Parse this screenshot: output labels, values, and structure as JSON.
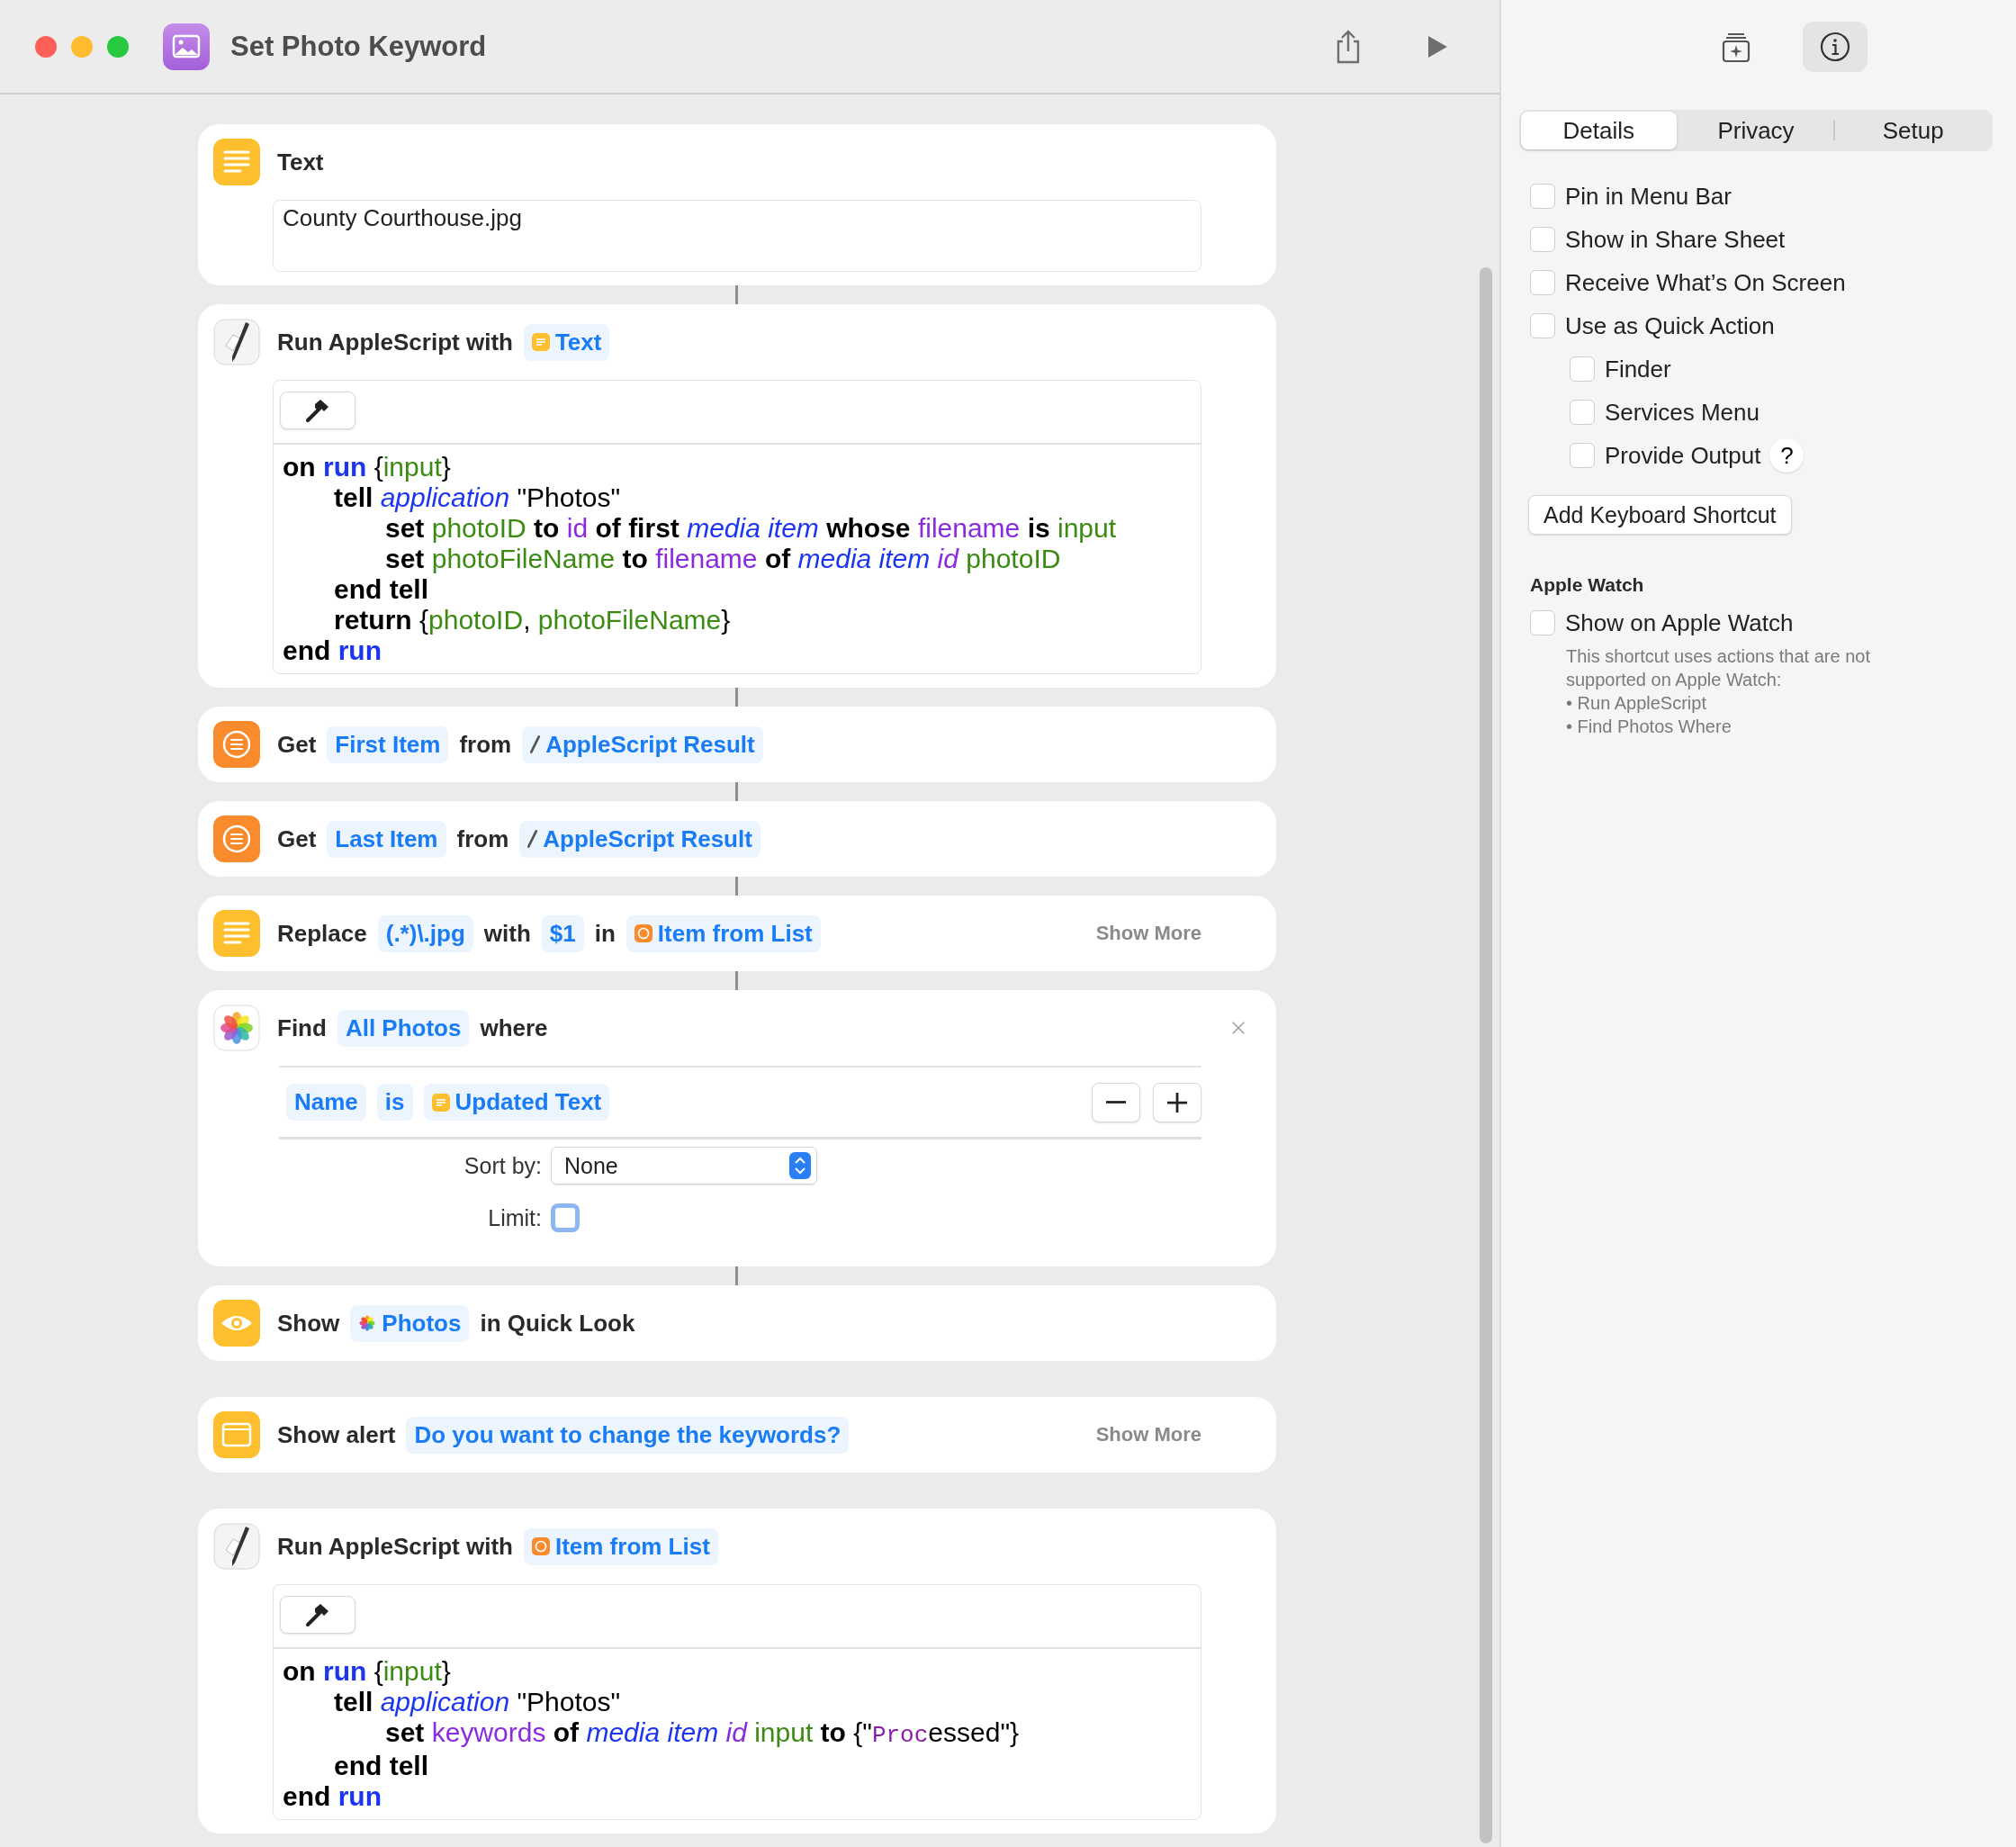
{
  "window": {
    "title": "Set Photo Keyword"
  },
  "actions": [
    {
      "kind": "text",
      "linked": false,
      "header": [
        {
          "kind": "word",
          "text": "Text"
        }
      ],
      "value": "County Courthouse.jpg"
    },
    {
      "kind": "script",
      "linked": true,
      "header": [
        {
          "kind": "word",
          "text": "Run AppleScript with"
        },
        {
          "kind": "text-result",
          "text": "Text"
        }
      ],
      "code": [
        {
          "tokens": [
            {
              "kind": "kw",
              "text": "on "
            },
            {
              "kind": "handler",
              "text": "run"
            },
            {
              "kind": "text",
              "text": " {"
            },
            {
              "kind": "var",
              "text": "input"
            },
            {
              "kind": "text",
              "text": "}"
            }
          ],
          "children": [
            {
              "tokens": [
                {
                  "kind": "kw",
                  "text": "tell "
                },
                {
                  "kind": "class",
                  "text": "application"
                },
                {
                  "kind": "text",
                  "text": " \"Photos\""
                }
              ],
              "children": [
                {
                  "tokens": [
                    {
                      "kind": "kw",
                      "text": "set "
                    },
                    {
                      "kind": "var",
                      "text": "photoID"
                    },
                    {
                      "kind": "kw",
                      "text": " to "
                    },
                    {
                      "kind": "prop",
                      "text": "id"
                    },
                    {
                      "kind": "kw",
                      "text": " of first "
                    },
                    {
                      "kind": "class",
                      "text": "media item"
                    },
                    {
                      "kind": "kw",
                      "text": " whose "
                    },
                    {
                      "kind": "prop",
                      "text": "filename"
                    },
                    {
                      "kind": "kw",
                      "text": " is "
                    },
                    {
                      "kind": "var",
                      "text": "input"
                    }
                  ]
                },
                {
                  "tokens": [
                    {
                      "kind": "kw",
                      "text": "set "
                    },
                    {
                      "kind": "var",
                      "text": "photoFileName"
                    },
                    {
                      "kind": "kw",
                      "text": " to "
                    },
                    {
                      "kind": "prop",
                      "text": "filename"
                    },
                    {
                      "kind": "kw",
                      "text": " of "
                    },
                    {
                      "kind": "class",
                      "text": "media item "
                    },
                    {
                      "kind": "propi",
                      "text": "id"
                    },
                    {
                      "kind": "var",
                      "text": " photoID"
                    }
                  ]
                }
              ]
            },
            {
              "tokens": [
                {
                  "kind": "kw",
                  "text": "end tell"
                }
              ]
            },
            {
              "tokens": [
                {
                  "kind": "kw",
                  "text": "return "
                },
                {
                  "kind": "text",
                  "text": "{"
                },
                {
                  "kind": "var",
                  "text": "photoID"
                },
                {
                  "kind": "text",
                  "text": ", "
                },
                {
                  "kind": "var",
                  "text": "photoFileName"
                },
                {
                  "kind": "text",
                  "text": "}"
                }
              ]
            }
          ]
        },
        {
          "tokens": [
            {
              "kind": "kw",
              "text": "end "
            },
            {
              "kind": "handler",
              "text": "run"
            }
          ]
        }
      ]
    },
    {
      "kind": "get",
      "linked": true,
      "header": [
        {
          "kind": "word",
          "text": "Get"
        },
        {
          "kind": "value",
          "text": "First Item"
        },
        {
          "kind": "word",
          "text": "from"
        },
        {
          "kind": "script-result",
          "text": "AppleScript Result"
        }
      ]
    },
    {
      "kind": "get",
      "linked": true,
      "header": [
        {
          "kind": "word",
          "text": "Get"
        },
        {
          "kind": "value",
          "text": "Last Item"
        },
        {
          "kind": "word",
          "text": "from"
        },
        {
          "kind": "script-result",
          "text": "AppleScript Result"
        }
      ]
    },
    {
      "kind": "replace",
      "linked": true,
      "header": [
        {
          "kind": "word",
          "text": "Replace"
        },
        {
          "kind": "value",
          "text": "(.*)\\.jpg"
        },
        {
          "kind": "word",
          "text": "with"
        },
        {
          "kind": "value",
          "text": "$1"
        },
        {
          "kind": "word",
          "text": "in"
        },
        {
          "kind": "list-result",
          "text": "Item from List"
        }
      ],
      "show_more": "Show More"
    },
    {
      "kind": "find",
      "linked": true,
      "closable": true,
      "header": [
        {
          "kind": "word",
          "text": "Find"
        },
        {
          "kind": "value",
          "text": "All Photos"
        },
        {
          "kind": "word",
          "text": "where"
        }
      ],
      "condition": [
        {
          "kind": "value",
          "text": "Name"
        },
        {
          "kind": "value",
          "text": "is"
        },
        {
          "kind": "text-result",
          "text": "Updated Text"
        }
      ],
      "sort_label": "Sort by:",
      "sort_value": "None",
      "limit_label": "Limit:",
      "limit_checked": false
    },
    {
      "kind": "show",
      "linked": true,
      "header": [
        {
          "kind": "word",
          "text": "Show"
        },
        {
          "kind": "photos-result",
          "text": "Photos"
        },
        {
          "kind": "word",
          "text": "in Quick Look"
        }
      ]
    },
    {
      "kind": "alert",
      "linked": false,
      "header": [
        {
          "kind": "word",
          "text": "Show alert"
        },
        {
          "kind": "value",
          "text": "Do you want to change the keywords?"
        }
      ],
      "show_more": "Show More"
    },
    {
      "kind": "script",
      "linked": false,
      "header": [
        {
          "kind": "word",
          "text": "Run AppleScript with"
        },
        {
          "kind": "list-result",
          "text": "Item from List"
        }
      ],
      "code": [
        {
          "tokens": [
            {
              "kind": "kw",
              "text": "on "
            },
            {
              "kind": "handler",
              "text": "run"
            },
            {
              "kind": "text",
              "text": " {"
            },
            {
              "kind": "var",
              "text": "input"
            },
            {
              "kind": "text",
              "text": "}"
            }
          ],
          "children": [
            {
              "tokens": [
                {
                  "kind": "kw",
                  "text": "tell "
                },
                {
                  "kind": "class",
                  "text": "application"
                },
                {
                  "kind": "text",
                  "text": " \"Photos\""
                }
              ],
              "children": [
                {
                  "tokens": [
                    {
                      "kind": "kw",
                      "text": "set "
                    },
                    {
                      "kind": "prop",
                      "text": "keywords"
                    },
                    {
                      "kind": "kw",
                      "text": " of "
                    },
                    {
                      "kind": "class",
                      "text": "media item "
                    },
                    {
                      "kind": "propi",
                      "text": "id"
                    },
                    {
                      "kind": "var",
                      "text": " input"
                    },
                    {
                      "kind": "kw",
                      "text": " to "
                    },
                    {
                      "kind": "text",
                      "text": "{\""
                    },
                    {
                      "kind": "mono",
                      "text": "Proc"
                    },
                    {
                      "kind": "text",
                      "text": "essed\"}"
                    }
                  ]
                }
              ]
            },
            {
              "tokens": [
                {
                  "kind": "kw",
                  "text": "end tell"
                }
              ]
            }
          ]
        },
        {
          "tokens": [
            {
              "kind": "kw",
              "text": "end "
            },
            {
              "kind": "handler",
              "text": "run"
            }
          ]
        }
      ]
    }
  ],
  "inspector": {
    "toolbar": [
      {
        "kind": "library",
        "selected": false
      },
      {
        "kind": "info",
        "selected": true
      }
    ],
    "tabs": [
      {
        "label": "Details",
        "selected": true
      },
      {
        "label": "Privacy",
        "selected": false
      },
      {
        "label": "Setup",
        "selected": false
      }
    ],
    "options": [
      {
        "label": "Pin in Menu Bar",
        "checked": false
      },
      {
        "label": "Show in Share Sheet",
        "checked": false
      },
      {
        "label": "Receive What’s On Screen",
        "checked": false
      },
      {
        "label": "Use as Quick Action",
        "checked": false,
        "children": [
          {
            "label": "Finder",
            "checked": false
          },
          {
            "label": "Services Menu",
            "checked": false
          },
          {
            "label": "Provide Output",
            "checked": false,
            "help": "?"
          }
        ]
      }
    ],
    "shortcut_button": "Add Keyboard Shortcut",
    "watch": {
      "heading": "Apple Watch",
      "option": {
        "label": "Show on Apple Watch",
        "checked": false
      },
      "note": "This shortcut uses actions that are not supported on Apple Watch:",
      "bullets": [
        "• Run AppleScript",
        "• Find Photos Where"
      ]
    }
  }
}
